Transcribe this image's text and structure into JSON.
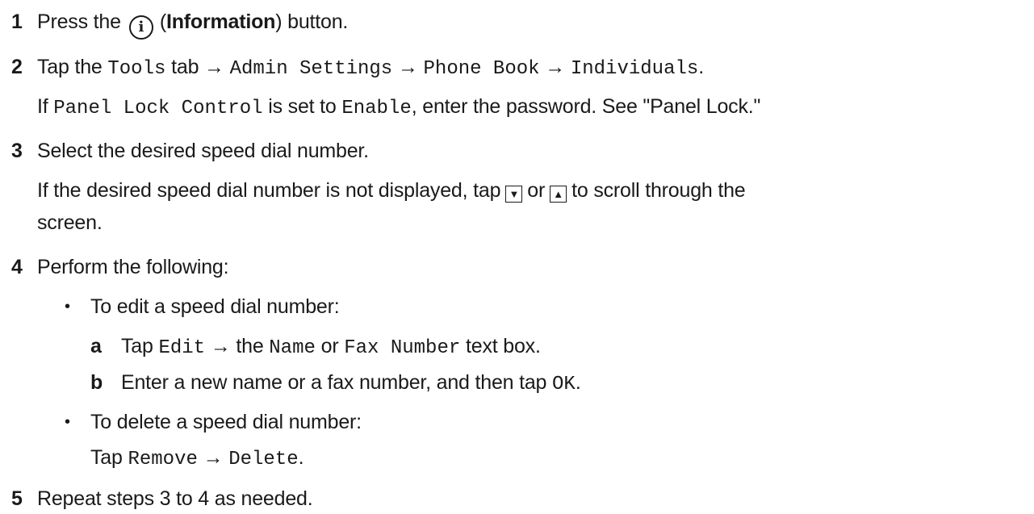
{
  "steps": [
    {
      "num": "1",
      "pre": "Press the",
      "mid": "(",
      "bold": "Information",
      "post": ") button."
    },
    {
      "num": "2",
      "a": "Tap the ",
      "b": "Tools",
      "c": " tab → ",
      "d": "Admin Settings",
      "e": " → ",
      "f": "Phone Book",
      "g": " → ",
      "h": "Individuals",
      "i": ".",
      "n_a": "If ",
      "n_b": "Panel Lock Control",
      "n_c": " is set to ",
      "n_d": "Enable",
      "n_e": ", enter the password. See \"Panel Lock.\""
    },
    {
      "num": "3",
      "text": "Select the desired speed dial number.",
      "n_a": "If the desired speed dial number is not displayed, tap",
      "n_b": "or",
      "n_c": "to scroll through the",
      "n_d": "screen."
    },
    {
      "num": "4",
      "text": "Perform the following:",
      "bullet1": "To edit a speed dial number:",
      "sa_label": "a",
      "sa_a": "Tap ",
      "sa_b": "Edit",
      "sa_c": " → the ",
      "sa_d": "Name",
      "sa_e": " or ",
      "sa_f": "Fax Number",
      "sa_g": " text box.",
      "sb_label": "b",
      "sb_a": "Enter a new name or a fax number, and then tap ",
      "sb_b": "OK",
      "sb_c": ".",
      "bullet2": "To delete a speed dial number:",
      "del_a": "Tap ",
      "del_b": "Remove",
      "del_c": " → ",
      "del_d": "Delete",
      "del_e": "."
    },
    {
      "num": "5",
      "text": "Repeat steps 3 to 4 as needed."
    }
  ],
  "icons": {
    "info": "information-icon",
    "down": "down-arrow-icon",
    "up": "up-arrow-icon"
  },
  "bullet_char": "•"
}
